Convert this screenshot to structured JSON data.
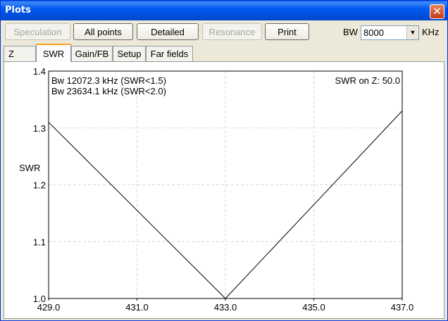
{
  "window": {
    "title": "Plots",
    "close_glyph": "✕"
  },
  "toolbar": {
    "buttons": [
      {
        "label": "Speculation",
        "enabled": false
      },
      {
        "label": "All points",
        "enabled": true
      },
      {
        "label": "Detailed",
        "enabled": true
      },
      {
        "label": "Resonance",
        "enabled": false
      },
      {
        "label": "Print",
        "enabled": true
      }
    ],
    "bw_label": "BW",
    "bw_value": "8000",
    "bw_unit": "KHz"
  },
  "tabs": [
    {
      "label": "Z",
      "active": false
    },
    {
      "label": "SWR",
      "active": true
    },
    {
      "label": "Gain/FB",
      "active": false
    },
    {
      "label": "Setup",
      "active": false
    },
    {
      "label": "Far fields",
      "active": false
    }
  ],
  "plot": {
    "annotation_lines": [
      "Bw 12072.3 kHz (SWR<1.5)",
      "Bw 23634.1 kHz (SWR<2.0)"
    ],
    "z_note": "SWR on Z: 50.0"
  },
  "chart_data": {
    "type": "line",
    "ylabel": "SWR",
    "xlim": [
      429.0,
      437.0
    ],
    "ylim": [
      1.0,
      1.4
    ],
    "x_ticks": [
      "429.0",
      "431.0",
      "433.0",
      "435.0",
      "437.0"
    ],
    "y_ticks": [
      "1.0",
      "1.1",
      "1.2",
      "1.3",
      "1.4"
    ],
    "grid": true,
    "series": [
      {
        "x": [
          429.0,
          433.0,
          437.0
        ],
        "y": [
          1.31,
          1.0,
          1.33
        ]
      }
    ],
    "colors": {
      "line": "#000000",
      "grid": "#d8d8d8"
    }
  }
}
